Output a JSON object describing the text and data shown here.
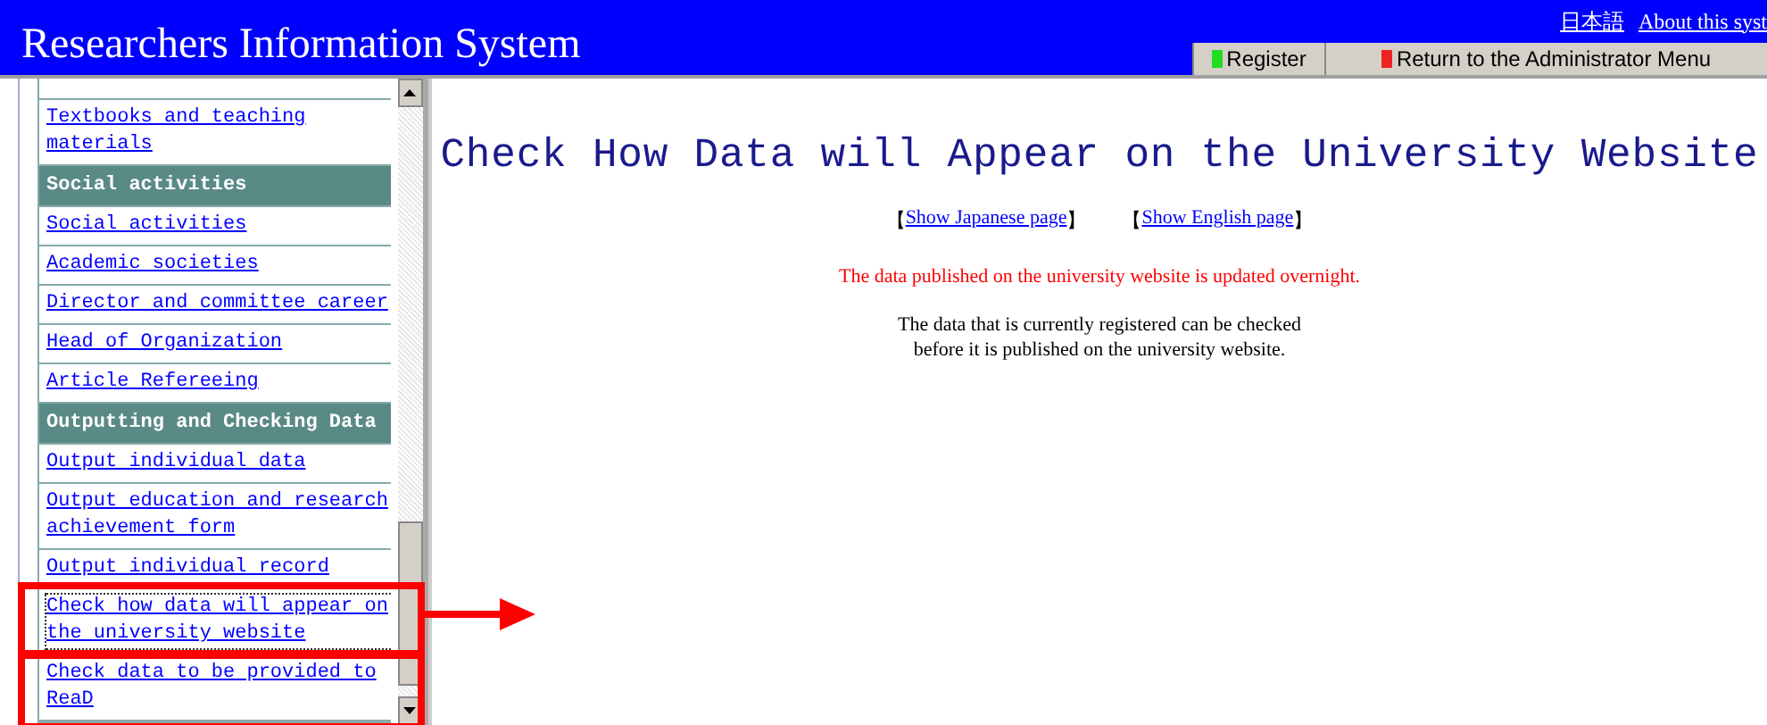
{
  "header": {
    "title": "Researchers Information System",
    "links": [
      "日本語",
      "About this syst"
    ],
    "tabs": [
      {
        "label": "Register",
        "color": "#22dd22"
      },
      {
        "label": "Return to the Administrator Menu",
        "color": "#ee2222"
      }
    ]
  },
  "sidebar": {
    "items": [
      {
        "kind": "link",
        "label": "Textbooks and teaching materials",
        "focused": false
      },
      {
        "kind": "heading",
        "label": "Social activities"
      },
      {
        "kind": "link",
        "label": "Social activities",
        "focused": false
      },
      {
        "kind": "link",
        "label": "Academic societies",
        "focused": false
      },
      {
        "kind": "link",
        "label": "Director and committee career",
        "focused": false
      },
      {
        "kind": "link",
        "label": "Head of Organization",
        "focused": false
      },
      {
        "kind": "link",
        "label": "Article Refereeing",
        "focused": false
      },
      {
        "kind": "heading",
        "label": "Outputting and Checking Data"
      },
      {
        "kind": "link",
        "label": "Output individual data",
        "focused": false
      },
      {
        "kind": "link",
        "label": "Output education and research achievement form",
        "focused": false
      },
      {
        "kind": "link",
        "label": "Output individual record",
        "focused": false
      },
      {
        "kind": "link",
        "label": "Check how data will appear on the university website",
        "focused": true
      },
      {
        "kind": "link",
        "label": "Check data to be provided to ReaD",
        "focused": false
      }
    ]
  },
  "main": {
    "title": "Check How Data will Appear on the University Website",
    "page_links": [
      {
        "open": "【",
        "label": "Show Japanese page",
        "close": "】"
      },
      {
        "open": "【",
        "label": "Show English page",
        "close": "】"
      }
    ],
    "notice": "The data published on the university website is updated overnight.",
    "description": [
      "The data that is currently registered can be checked",
      "before it is published on the university website."
    ]
  }
}
